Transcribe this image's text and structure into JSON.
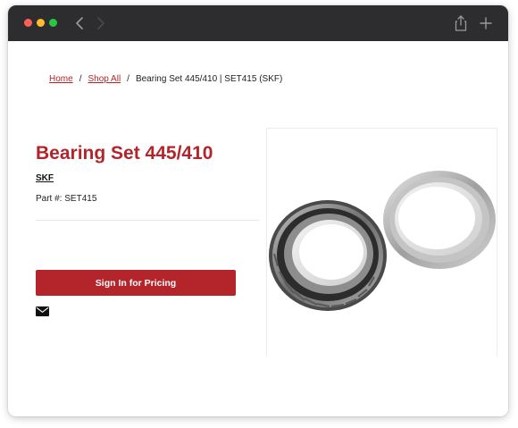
{
  "browser": {
    "icons": [
      "back-icon",
      "forward-icon",
      "share-icon",
      "new-tab-icon"
    ]
  },
  "breadcrumb": {
    "home": "Home",
    "shop_all": "Shop All",
    "separator": "/",
    "current": "Bearing Set 445/410 | SET415 (SKF)"
  },
  "product": {
    "title": "Bearing Set 445/410",
    "brand": "SKF",
    "part_label": "Part #:",
    "part_number": "SET415",
    "image_icon": "tapered-roller-bearing-image"
  },
  "actions": {
    "pricing_button": "Sign In for Pricing",
    "email_icon": "envelope-icon"
  },
  "colors": {
    "accent": "#b3252a",
    "titlebar": "#2d2d2f"
  }
}
